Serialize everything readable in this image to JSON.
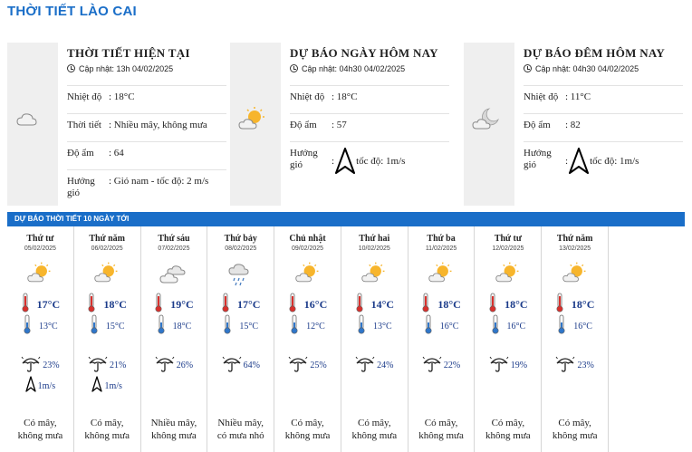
{
  "page_title": "THỜI TIẾT LÀO CAI",
  "current": {
    "title": "THỜI TIẾT HIỆN TẠI",
    "updated": "Cập nhật: 13h 04/02/2025",
    "icon": "cloudy-icon",
    "rows": [
      {
        "label": "Nhiệt độ",
        "value": ": 18°C"
      },
      {
        "label": "Thời tiết",
        "value": ": Nhiều mây, không mưa"
      },
      {
        "label": "Độ ẩm",
        "value": ": 64"
      },
      {
        "label": "Hướng gió",
        "value": ": Gió nam - tốc độ: 2 m/s"
      }
    ]
  },
  "today": {
    "title": "DỰ BÁO NGÀY HÔM NAY",
    "updated": "Cập nhật: 04h30 04/02/2025",
    "icon": "partly-cloudy-day-icon",
    "rows": [
      {
        "label": "Nhiệt độ",
        "value": ": 18°C"
      },
      {
        "label": "Độ ẩm",
        "value": ": 57"
      },
      {
        "label": "Hướng gió",
        "value": ":",
        "speed": "tốc độ: 1m/s"
      }
    ]
  },
  "tonight": {
    "title": "DỰ BÁO ĐÊM HÔM NAY",
    "updated": "Cập nhật: 04h30 04/02/2025",
    "icon": "partly-cloudy-night-icon",
    "rows": [
      {
        "label": "Nhiệt độ",
        "value": ": 11°C"
      },
      {
        "label": "Độ ẩm",
        "value": ": 82"
      },
      {
        "label": "Hướng gió",
        "value": ":",
        "speed": "tốc độ: 1m/s"
      }
    ]
  },
  "forecast_title": "DỰ BÁO THỜI TIẾT 10 NGÀY TỚI",
  "days": [
    {
      "name": "Thứ tư",
      "date": "05/02/2025",
      "icon": "partly-cloudy-day-icon",
      "hi": "17°C",
      "lo": "13°C",
      "rain": "23%",
      "wind": "1m/s",
      "desc1": "Có mây,",
      "desc2": "không mưa"
    },
    {
      "name": "Thứ năm",
      "date": "06/02/2025",
      "icon": "partly-cloudy-day-icon",
      "hi": "18°C",
      "lo": "15°C",
      "rain": "21%",
      "wind": "1m/s",
      "desc1": "Có mây,",
      "desc2": "không mưa"
    },
    {
      "name": "Thứ sáu",
      "date": "07/02/2025",
      "icon": "cloudy-icon",
      "hi": "19°C",
      "lo": "18°C",
      "rain": "26%",
      "wind": "",
      "desc1": "Nhiều mây,",
      "desc2": "không mưa"
    },
    {
      "name": "Thứ bảy",
      "date": "08/02/2025",
      "icon": "light-rain-icon",
      "hi": "17°C",
      "lo": "15°C",
      "rain": "64%",
      "wind": "",
      "desc1": "Nhiều mây,",
      "desc2": "có mưa nhỏ"
    },
    {
      "name": "Chủ nhật",
      "date": "09/02/2025",
      "icon": "partly-cloudy-day-icon",
      "hi": "16°C",
      "lo": "12°C",
      "rain": "25%",
      "wind": "",
      "desc1": "Có mây,",
      "desc2": "không mưa"
    },
    {
      "name": "Thứ hai",
      "date": "10/02/2025",
      "icon": "partly-cloudy-day-icon",
      "hi": "14°C",
      "lo": "13°C",
      "rain": "24%",
      "wind": "",
      "desc1": "Có mây,",
      "desc2": "không mưa"
    },
    {
      "name": "Thứ ba",
      "date": "11/02/2025",
      "icon": "partly-cloudy-day-icon",
      "hi": "18°C",
      "lo": "16°C",
      "rain": "22%",
      "wind": "",
      "desc1": "Có mây,",
      "desc2": "không mưa"
    },
    {
      "name": "Thứ tư",
      "date": "12/02/2025",
      "icon": "partly-cloudy-day-icon",
      "hi": "18°C",
      "lo": "16°C",
      "rain": "19%",
      "wind": "",
      "desc1": "Có mây,",
      "desc2": "không mưa"
    },
    {
      "name": "Thứ năm",
      "date": "13/02/2025",
      "icon": "partly-cloudy-day-icon",
      "hi": "18°C",
      "lo": "16°C",
      "rain": "23%",
      "wind": "",
      "desc1": "Có mây,",
      "desc2": "không mưa"
    }
  ],
  "colors": {
    "accent": "#1a6ec8",
    "temp_text": "#1b3b8a",
    "thermo_red": "#d9302c",
    "thermo_blue": "#2f76c9",
    "sun": "#f7b52c"
  }
}
